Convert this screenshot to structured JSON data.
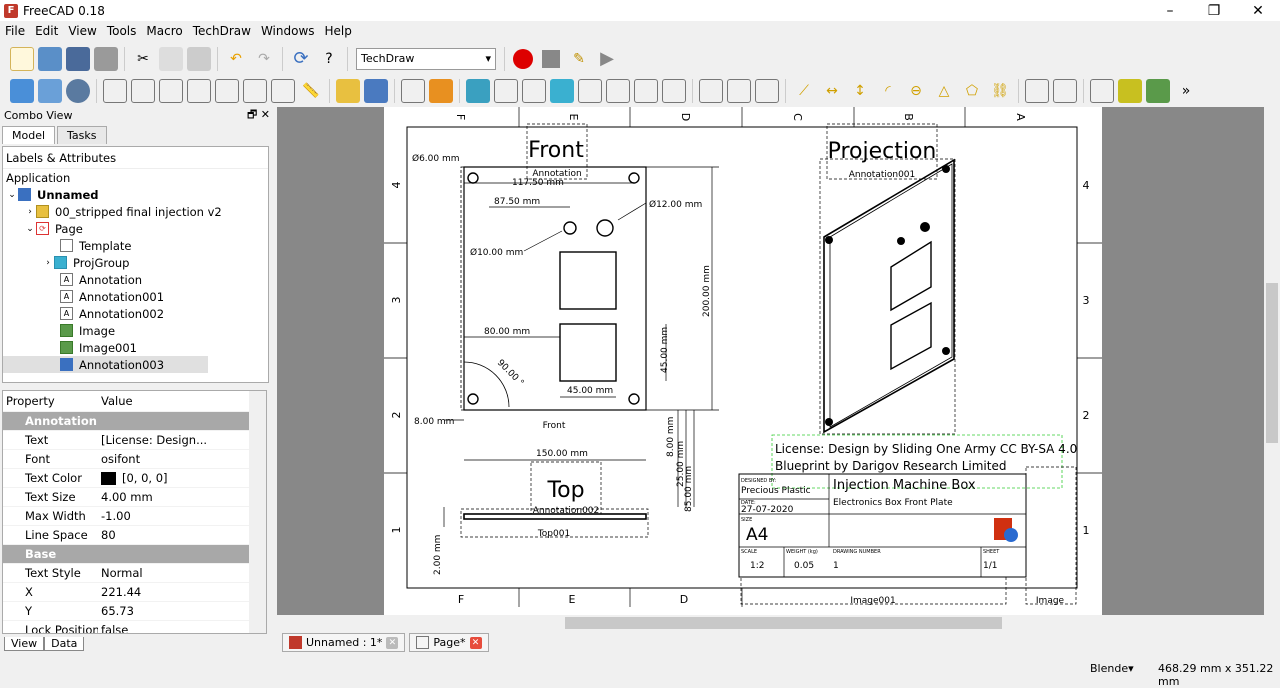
{
  "app": {
    "title": "FreeCAD 0.18",
    "minimize": "–",
    "restore": "❐",
    "close": "✕"
  },
  "menu": [
    "File",
    "Edit",
    "View",
    "Tools",
    "Macro",
    "TechDraw",
    "Windows",
    "Help"
  ],
  "workbench": "TechDraw",
  "combo": {
    "title": "Combo View",
    "tab_model": "Model",
    "tab_tasks": "Tasks"
  },
  "tree": {
    "header": "Labels & Attributes",
    "application": "Application",
    "doc": "Unnamed",
    "items": [
      "00_stripped final injection v2",
      "Page",
      "Template",
      "ProjGroup",
      "Annotation",
      "Annotation001",
      "Annotation002",
      "Image",
      "Image001",
      "Annotation003"
    ]
  },
  "props": {
    "h_property": "Property",
    "h_value": "Value",
    "rows": [
      {
        "group": "Annotation"
      },
      {
        "k": "Text",
        "v": "[License: Design..."
      },
      {
        "k": "Font",
        "v": "osifont"
      },
      {
        "k": "Text Color",
        "v": "[0, 0, 0]"
      },
      {
        "k": "Text Size",
        "v": "4.00 mm"
      },
      {
        "k": "Max Width",
        "v": "-1.00"
      },
      {
        "k": "Line Space",
        "v": "80"
      },
      {
        "group": "Base"
      },
      {
        "k": "Text Style",
        "v": "Normal"
      },
      {
        "k": "X",
        "v": "221.44"
      },
      {
        "k": "Y",
        "v": "65.73"
      },
      {
        "k": "Lock Position",
        "v": "false"
      }
    ]
  },
  "bottom_tabs": {
    "view": "View",
    "data": "Data"
  },
  "doc_tabs": {
    "t1": "Unnamed : 1*",
    "t2": "Page*"
  },
  "status": {
    "nav": "Blende▾",
    "dims": "468.29 mm x 351.22 mm"
  },
  "drawing": {
    "cols_top": [
      "F",
      "E",
      "D",
      "C",
      "B",
      "A"
    ],
    "cols_bottom": [
      "F",
      "E",
      "D"
    ],
    "rows": [
      "4",
      "3",
      "2",
      "1"
    ],
    "view_front": "Front",
    "view_projection": "Projection",
    "view_top": "Top",
    "ann_front": "Annotation",
    "ann_proj": "Annotation001",
    "ann_top": "Annotation002",
    "lbl_front": "Front",
    "lbl_top": "Top001",
    "lbl_image": "Image001",
    "lbl_image2": "Image",
    "dims": [
      "Ø6.00 mm",
      "117.50 mm",
      "87.50 mm",
      "Ø12.00 mm",
      "Ø10.00 mm",
      "200.00 mm",
      "80.00 mm",
      "45.00 mm",
      "45.00 mm",
      "90.00 °",
      "8.00 mm",
      "150.00 mm",
      "8.00 mm",
      "25.00 mm",
      "85.00 mm",
      "2.00 mm"
    ],
    "license1": "License: Design by Sliding One Army CC BY-SA 4.0",
    "license2": "Blueprint by Darigov Research Limited",
    "tb": {
      "designed_by_lbl": "DESIGNED BY:",
      "designed_by": "Precious Plastic",
      "date_lbl": "DATE:",
      "date": "27-07-2020",
      "size_lbl": "SIZE",
      "size": "A4",
      "title": "Injection Machine Box",
      "subtitle": "Electronics Box Front Plate",
      "scale_lbl": "SCALE",
      "scale": "1:2",
      "weight_lbl": "WEIGHT (kg)",
      "weight": "0.05",
      "dwg_lbl": "DRAWING NUMBER",
      "dwg": "1",
      "sheet_lbl": "SHEET",
      "sheet": "1/1"
    }
  }
}
